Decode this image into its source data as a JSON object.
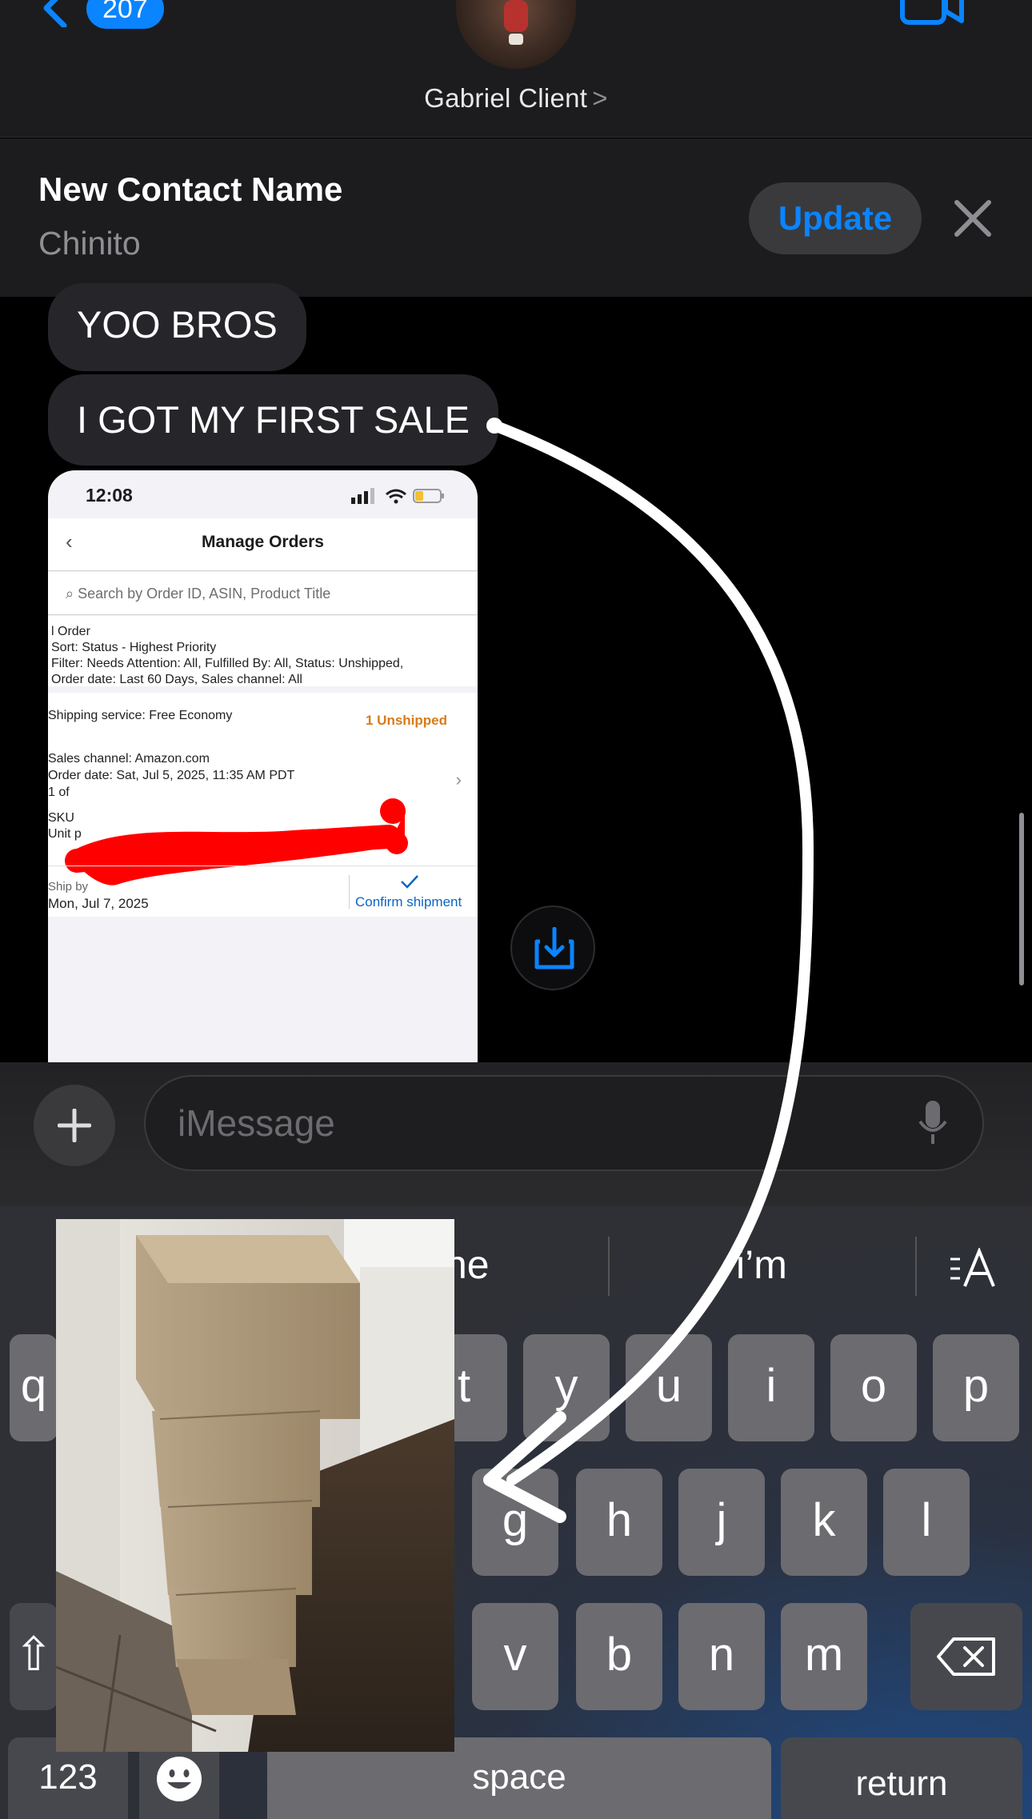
{
  "nav": {
    "unread_badge": "207",
    "contact_name": "Gabriel Client",
    "contact_chevron": ">"
  },
  "banner": {
    "title": "New Contact Name",
    "subtitle": "Chinito",
    "update_label": "Update"
  },
  "messages": [
    {
      "text": "YOO BROS"
    },
    {
      "text": "I GOT MY FIRST SALE"
    }
  ],
  "screenshot": {
    "time": "12:08",
    "header_title": "Manage Orders",
    "search_placeholder": "Search by Order ID, ASIN, Product Title",
    "filter_lines": [
      "l Order",
      "Sort: Status - Highest Priority",
      "Filter: Needs Attention: All, Fulfilled By: All, Status: Unshipped,",
      "Order date: Last 60 Days, Sales channel: All"
    ],
    "shipping_service": "Shipping service: Free Economy",
    "unshipped": "1 Unshipped",
    "sales_channel": "Sales channel: Amazon.com",
    "order_date": "Order date: Sat, Jul 5, 2025, 11:35 AM PDT",
    "partial_lines": [
      "1 of",
      "SKU",
      "Unit p"
    ],
    "ship_by_label": "Ship by",
    "ship_by_date": "Mon, Jul 7, 2025",
    "confirm_label": "Confirm shipment"
  },
  "input": {
    "placeholder": "iMessage"
  },
  "keyboard": {
    "suggestions": [
      "he",
      "i’m"
    ],
    "row1": [
      "q",
      "t",
      "y",
      "u",
      "i",
      "o",
      "p"
    ],
    "row2": [
      "g",
      "h",
      "j",
      "k",
      "l"
    ],
    "row3": [
      "v",
      "b",
      "n",
      "m"
    ],
    "shift_partial": "⇧",
    "num_label": "123",
    "space_label": "space",
    "return_label": "return"
  },
  "colors": {
    "accent": "#0a84ff",
    "bubble": "#26262a",
    "unshipped": "#d87b1a"
  }
}
